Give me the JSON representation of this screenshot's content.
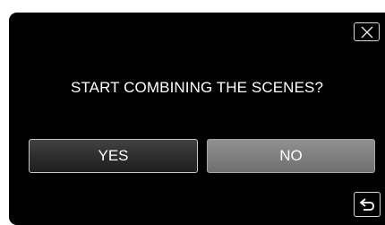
{
  "dialog": {
    "prompt": "START COMBINING THE SCENES?",
    "yes_label": "YES",
    "no_label": "NO"
  },
  "icons": {
    "close": "close-icon",
    "back": "back-arrow-icon"
  },
  "colors": {
    "screen_background": "#000000",
    "text": "#ffffff",
    "yes_button": "#333333",
    "no_button": "#858585",
    "button_border": "#c8c8c8"
  }
}
